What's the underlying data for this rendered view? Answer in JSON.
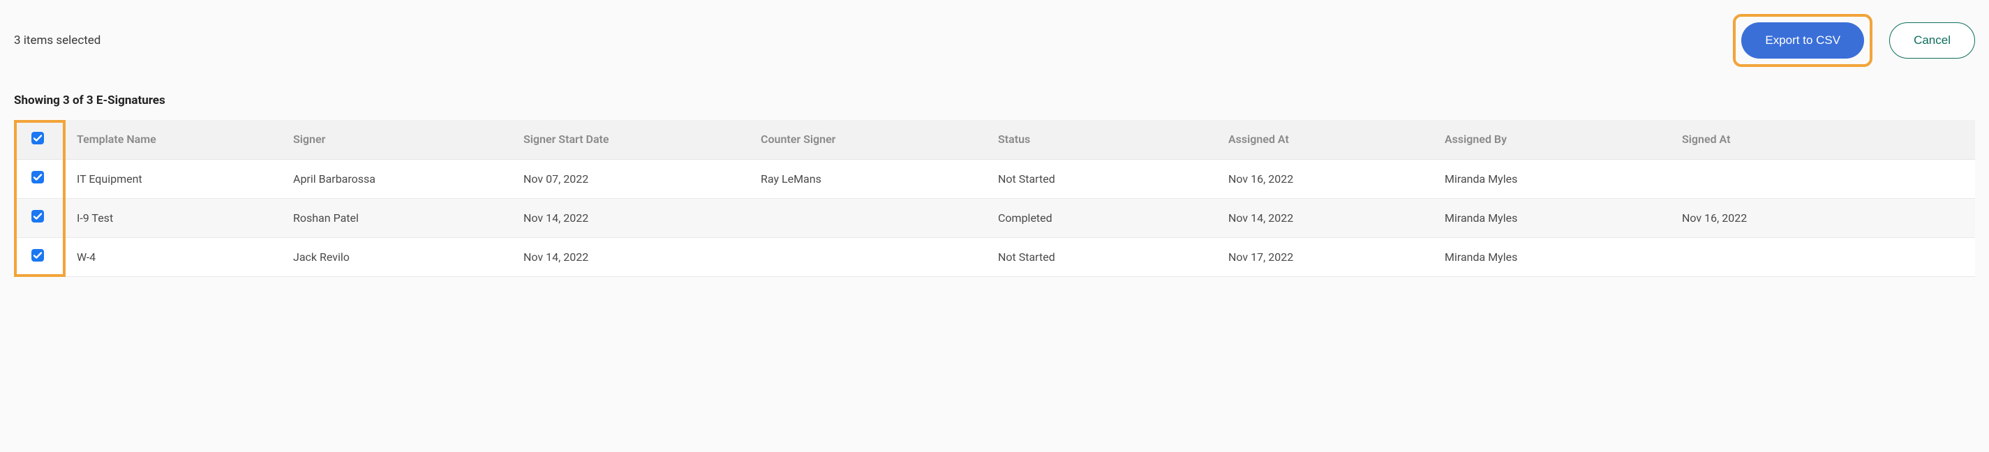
{
  "top": {
    "selection_text": "3 items selected",
    "export_label": "Export to CSV",
    "cancel_label": "Cancel"
  },
  "summary_text": "Showing 3 of 3 E-Signatures",
  "columns": {
    "template": "Template Name",
    "signer": "Signer",
    "signer_start": "Signer Start Date",
    "counter_signer": "Counter Signer",
    "status": "Status",
    "assigned_at": "Assigned At",
    "assigned_by": "Assigned By",
    "signed_at": "Signed At"
  },
  "rows": [
    {
      "checked": true,
      "template": "IT Equipment",
      "signer": "April Barbarossa",
      "signer_start": "Nov 07, 2022",
      "counter_signer": "Ray LeMans",
      "status": "Not Started",
      "assigned_at": "Nov 16, 2022",
      "assigned_by": "Miranda Myles",
      "signed_at": ""
    },
    {
      "checked": true,
      "template": "I-9 Test",
      "signer": "Roshan Patel",
      "signer_start": "Nov 14, 2022",
      "counter_signer": "",
      "status": "Completed",
      "assigned_at": "Nov 14, 2022",
      "assigned_by": "Miranda Myles",
      "signed_at": "Nov 16, 2022"
    },
    {
      "checked": true,
      "template": "W-4",
      "signer": "Jack Revilo",
      "signer_start": "Nov 14, 2022",
      "counter_signer": "",
      "status": "Not Started",
      "assigned_at": "Nov 17, 2022",
      "assigned_by": "Miranda Myles",
      "signed_at": ""
    }
  ],
  "header_checked": true,
  "colors": {
    "primary_button": "#3b6fd8",
    "secondary_button_border": "#0e6e5c",
    "highlight": "#f2a43a",
    "checkbox": "#1b77f2"
  }
}
